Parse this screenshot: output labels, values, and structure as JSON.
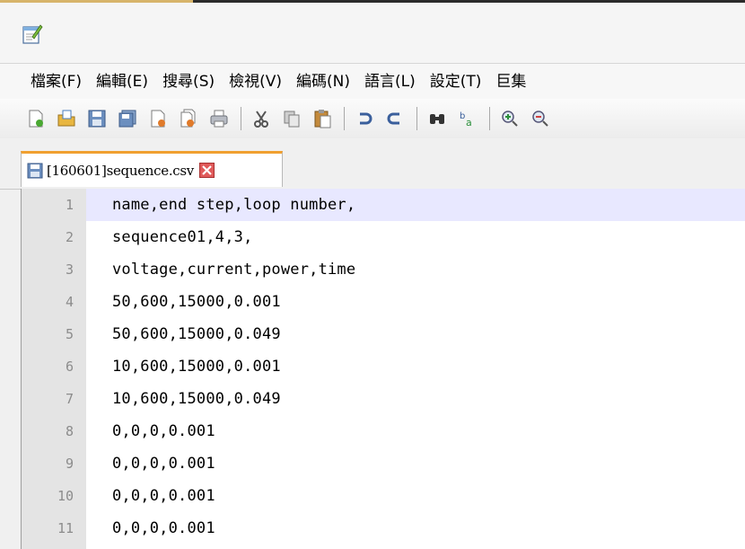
{
  "menu": {
    "items": [
      "檔案(F)",
      "編輯(E)",
      "搜尋(S)",
      "檢視(V)",
      "編碼(N)",
      "語言(L)",
      "設定(T)",
      "巨集"
    ]
  },
  "toolbar": {
    "icons": [
      "new-file-icon",
      "open-file-icon",
      "save-icon",
      "save-all-icon",
      "close-icon",
      "close-all-icon",
      "print-icon",
      "cut-icon",
      "copy-icon",
      "paste-icon",
      "undo-icon",
      "redo-icon",
      "find-icon",
      "replace-icon",
      "zoom-in-icon",
      "zoom-out-icon"
    ]
  },
  "tab": {
    "label": "[160601]sequence.csv"
  },
  "editor": {
    "lines": [
      {
        "num": "1",
        "text": "name,end step,loop number,"
      },
      {
        "num": "2",
        "text": "sequence01,4,3,"
      },
      {
        "num": "3",
        "text": "voltage,current,power,time"
      },
      {
        "num": "4",
        "text": "50,600,15000,0.001"
      },
      {
        "num": "5",
        "text": "50,600,15000,0.049"
      },
      {
        "num": "6",
        "text": "10,600,15000,0.001"
      },
      {
        "num": "7",
        "text": "10,600,15000,0.049"
      },
      {
        "num": "8",
        "text": "0,0,0,0.001"
      },
      {
        "num": "9",
        "text": "0,0,0,0.001"
      },
      {
        "num": "10",
        "text": "0,0,0,0.001"
      },
      {
        "num": "11",
        "text": "0,0,0,0.001"
      }
    ]
  },
  "colors": {
    "current_line": "#e8e8ff",
    "gutter": "#e4e4e4",
    "tab_accent": "#f0a030"
  }
}
